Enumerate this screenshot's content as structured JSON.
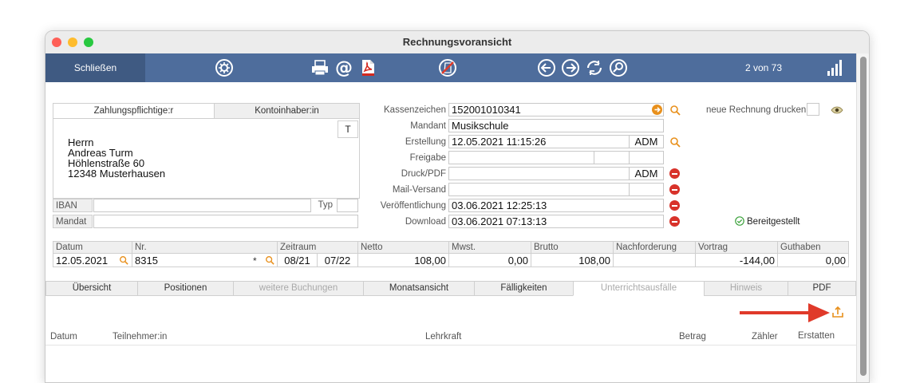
{
  "window": {
    "title": "Rechnungsvoransicht"
  },
  "toolbar": {
    "close_label": "Schließen",
    "record_count": "2 von 73",
    "icons": [
      "settings-icon",
      "printer-icon",
      "email-icon",
      "pdf-icon",
      "cancel-icon",
      "previous-icon",
      "next-icon",
      "refresh-icon",
      "search-icon",
      "signal-icon"
    ]
  },
  "address": {
    "tab_payer": "Zahlungspflichtige:r",
    "tab_holder": "Kontoinhaber:in",
    "t_button": "T",
    "lines": [
      "Herrn",
      "Andreas Turm",
      "Höhlenstraße 60",
      "12348 Musterhausen"
    ],
    "iban_label": "IBAN",
    "iban_value": "",
    "typ_label": "Typ",
    "typ_value": "",
    "mandat_label": "Mandat",
    "mandat_value": ""
  },
  "details": {
    "kassenzeichen": {
      "label": "Kassenzeichen",
      "value": "152001010341"
    },
    "mandant": {
      "label": "Mandant",
      "value": "Musikschule"
    },
    "erstellung": {
      "label": "Erstellung",
      "value": "12.05.2021 11:15:26",
      "user": "ADM"
    },
    "freigabe": {
      "label": "Freigabe",
      "value": ""
    },
    "druck_pdf": {
      "label": "Druck/PDF",
      "value": "",
      "user": "ADM"
    },
    "mail_versand": {
      "label": "Mail-Versand",
      "value": ""
    },
    "veroeffentlichung": {
      "label": "Veröffentlichung",
      "value": "03.06.2021 12:25:13"
    },
    "download": {
      "label": "Download",
      "value": "03.06.2021 07:13:13"
    }
  },
  "right_panel": {
    "reprint_label": "neue Rechnung drucken",
    "status_text": "Bereitgestellt",
    "status_color": "#3ba13b"
  },
  "summary": {
    "headers": [
      "Datum",
      "Nr.",
      "Zeitraum",
      "Netto",
      "Mwst.",
      "Brutto",
      "Nachforderung",
      "Vortrag",
      "Guthaben"
    ],
    "datum": "12.05.2021",
    "nr": "8315",
    "nr_flag": "*",
    "zeitraum_from": "08/21",
    "zeitraum_to": "07/22",
    "netto": "108,00",
    "mwst": "0,00",
    "brutto": "108,00",
    "nachforderung": "",
    "vortrag": "-144,00",
    "guthaben": "0,00"
  },
  "tabs": [
    "Übersicht",
    "Positionen",
    "weitere Buchungen",
    "Monatsansicht",
    "Fälligkeiten",
    "Unterrichtsausfälle",
    "Hinweis",
    "PDF"
  ],
  "active_tab": "Unterrichtsausfälle",
  "list_headers": {
    "datum": "Datum",
    "teilnehmer": "Teilnehmer:in",
    "lehrkraft": "Lehrkraft",
    "betrag": "Betrag",
    "zaehler": "Zähler",
    "erstatten": "Erstatten"
  },
  "colors": {
    "toolbar": "#4e6d9c",
    "close_button": "#3f5a82",
    "accent_orange": "#e8901c",
    "arrow_red": "#e03a2a"
  }
}
